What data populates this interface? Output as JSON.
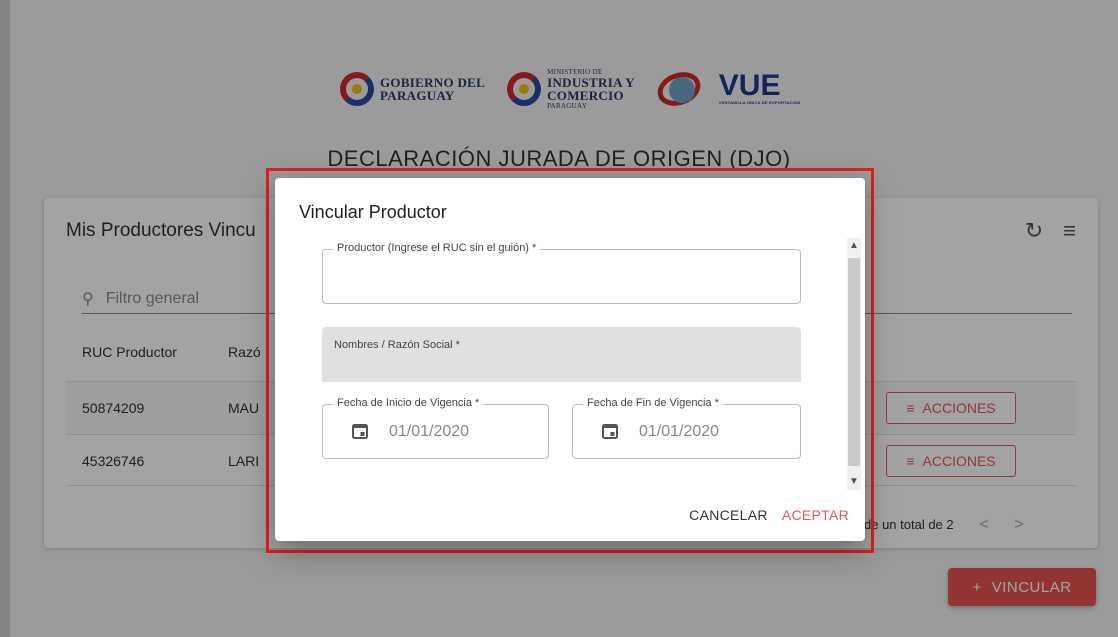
{
  "header": {
    "logos": [
      {
        "name": "gobierno-paraguay",
        "line1": "GOBIERNO DEL",
        "line2": "PARAGUAY"
      },
      {
        "name": "ministerio-industria-comercio",
        "small_top": "MINISTERIO DE",
        "line1": "INDUSTRIA Y",
        "line2": "COMERCIO",
        "small_bottom": "PARAGUAY"
      },
      {
        "name": "vue",
        "text": "VUE",
        "tagline": "VENTANILLA ÚNICA DE EXPORTACIÓN"
      }
    ],
    "title": "DECLARACIÓN JURADA DE ORIGEN (DJO)"
  },
  "card": {
    "title": "Mis Productores Vincu",
    "search": {
      "placeholder": "Filtro general",
      "icon": "search-icon"
    },
    "tools": {
      "refresh_icon": "refresh-icon",
      "filter_icon": "filter-icon"
    },
    "columns": [
      "RUC Productor",
      "Razó"
    ],
    "rows": [
      {
        "ruc": "50874209",
        "name": "MAU",
        "action": "ACCIONES"
      },
      {
        "ruc": "45326746",
        "name": "LARI",
        "action": "ACCIONES"
      }
    ],
    "pager": {
      "text": "de un total de 2",
      "prev": "<",
      "next": ">"
    }
  },
  "fab": {
    "label": "VINCULAR",
    "icon": "+"
  },
  "dialog": {
    "title": "Vincular Productor",
    "fields": {
      "productor": {
        "label": "Productor (Ingrese el RUC sin el guión) *",
        "value": ""
      },
      "razon_social": {
        "label": "Nombres / Razón Social *",
        "value": ""
      },
      "fecha_inicio": {
        "label": "Fecha de Inicio de Vigencia *",
        "value": "01/01/2020"
      },
      "fecha_fin": {
        "label": "Fecha de Fin de Vigencia *",
        "value": "01/01/2020"
      }
    },
    "cancel_label": "CANCELAR",
    "accept_label": "ACEPTAR"
  },
  "colors": {
    "accent": "#e25a5a",
    "highlight": "#e0201e"
  }
}
